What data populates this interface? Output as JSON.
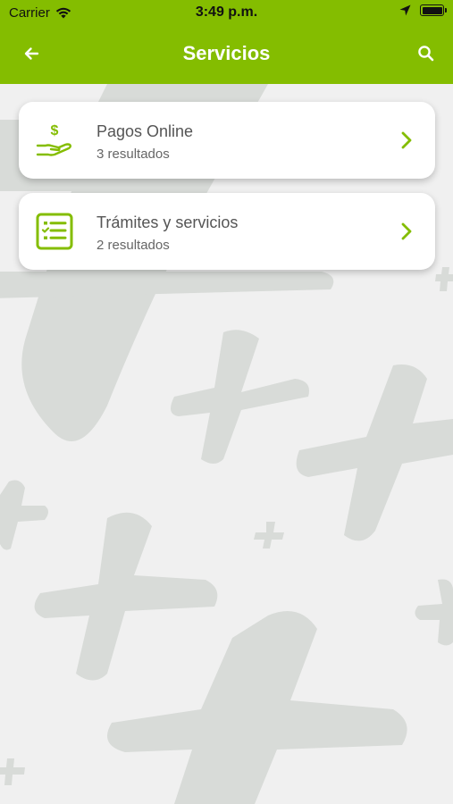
{
  "status_bar": {
    "carrier": "Carrier",
    "time": "3:49 p.m."
  },
  "header": {
    "title": "Servicios",
    "back_icon": "arrow-left-icon",
    "search_icon": "search-icon"
  },
  "services": [
    {
      "title": "Pagos Online",
      "subtitle": "3 resultados",
      "icon": "hand-dollar-icon"
    },
    {
      "title": "Trámites y servicios",
      "subtitle": "2 resultados",
      "icon": "checklist-icon"
    }
  ],
  "colors": {
    "brand": "#84bd00",
    "background": "#f0f0f0",
    "pattern": "#d6d9d6"
  }
}
